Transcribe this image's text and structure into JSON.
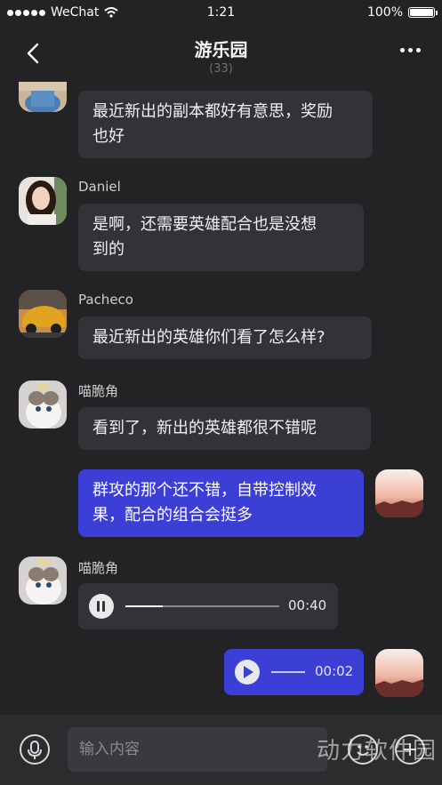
{
  "status_bar": {
    "carrier": "WeChat",
    "time": "1:21",
    "battery": "100%"
  },
  "header": {
    "title": "游乐园",
    "member_count": "(33)"
  },
  "messages": [
    {
      "sender": "",
      "text_lines": [
        "最近新出的副本都好有意思，奖励",
        "也好"
      ]
    },
    {
      "sender": "Daniel",
      "text_lines": [
        "是啊，还需要英雄配合也是没想",
        "到的"
      ]
    },
    {
      "sender": "Pacheco",
      "text_lines": [
        "最近新出的英雄你们看了怎么样?"
      ]
    },
    {
      "sender": "喵脆角",
      "text_lines": [
        "看到了，新出的英雄都很不错呢"
      ]
    },
    {
      "sender": "me",
      "text_lines": [
        "群攻的那个还不错，自带控制效",
        "果，配合的组合会挺多"
      ]
    },
    {
      "sender": "喵脆角",
      "voice": {
        "duration": "00:40",
        "progress": 0.24,
        "state": "pause"
      }
    },
    {
      "sender": "me",
      "voice": {
        "duration": "00:02",
        "state": "play"
      }
    }
  ],
  "composer": {
    "placeholder": "输入内容"
  },
  "watermark": "动力软件园",
  "colors": {
    "background": "#232325",
    "bubble_other": "#333337",
    "bubble_self": "#3b3fd6"
  },
  "icons": [
    "back-icon",
    "more-icon",
    "microphone-icon",
    "emoji-icon",
    "plus-icon",
    "play-icon",
    "pause-icon",
    "wifi-icon",
    "battery-icon"
  ]
}
